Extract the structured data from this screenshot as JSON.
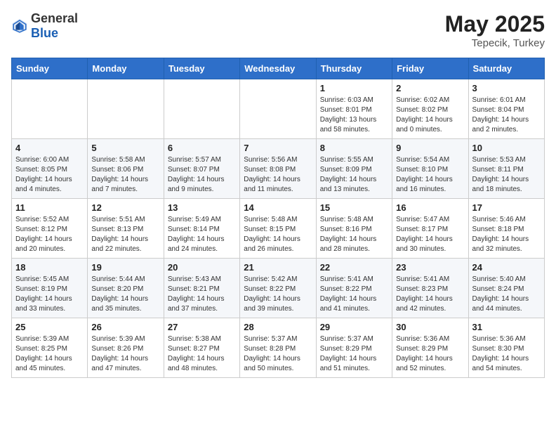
{
  "header": {
    "logo_general": "General",
    "logo_blue": "Blue",
    "month_year": "May 2025",
    "location": "Tepecik, Turkey"
  },
  "weekdays": [
    "Sunday",
    "Monday",
    "Tuesday",
    "Wednesday",
    "Thursday",
    "Friday",
    "Saturday"
  ],
  "weeks": [
    [
      {
        "day": "",
        "info": ""
      },
      {
        "day": "",
        "info": ""
      },
      {
        "day": "",
        "info": ""
      },
      {
        "day": "",
        "info": ""
      },
      {
        "day": "1",
        "info": "Sunrise: 6:03 AM\nSunset: 8:01 PM\nDaylight: 13 hours\nand 58 minutes."
      },
      {
        "day": "2",
        "info": "Sunrise: 6:02 AM\nSunset: 8:02 PM\nDaylight: 14 hours\nand 0 minutes."
      },
      {
        "day": "3",
        "info": "Sunrise: 6:01 AM\nSunset: 8:04 PM\nDaylight: 14 hours\nand 2 minutes."
      }
    ],
    [
      {
        "day": "4",
        "info": "Sunrise: 6:00 AM\nSunset: 8:05 PM\nDaylight: 14 hours\nand 4 minutes."
      },
      {
        "day": "5",
        "info": "Sunrise: 5:58 AM\nSunset: 8:06 PM\nDaylight: 14 hours\nand 7 minutes."
      },
      {
        "day": "6",
        "info": "Sunrise: 5:57 AM\nSunset: 8:07 PM\nDaylight: 14 hours\nand 9 minutes."
      },
      {
        "day": "7",
        "info": "Sunrise: 5:56 AM\nSunset: 8:08 PM\nDaylight: 14 hours\nand 11 minutes."
      },
      {
        "day": "8",
        "info": "Sunrise: 5:55 AM\nSunset: 8:09 PM\nDaylight: 14 hours\nand 13 minutes."
      },
      {
        "day": "9",
        "info": "Sunrise: 5:54 AM\nSunset: 8:10 PM\nDaylight: 14 hours\nand 16 minutes."
      },
      {
        "day": "10",
        "info": "Sunrise: 5:53 AM\nSunset: 8:11 PM\nDaylight: 14 hours\nand 18 minutes."
      }
    ],
    [
      {
        "day": "11",
        "info": "Sunrise: 5:52 AM\nSunset: 8:12 PM\nDaylight: 14 hours\nand 20 minutes."
      },
      {
        "day": "12",
        "info": "Sunrise: 5:51 AM\nSunset: 8:13 PM\nDaylight: 14 hours\nand 22 minutes."
      },
      {
        "day": "13",
        "info": "Sunrise: 5:49 AM\nSunset: 8:14 PM\nDaylight: 14 hours\nand 24 minutes."
      },
      {
        "day": "14",
        "info": "Sunrise: 5:48 AM\nSunset: 8:15 PM\nDaylight: 14 hours\nand 26 minutes."
      },
      {
        "day": "15",
        "info": "Sunrise: 5:48 AM\nSunset: 8:16 PM\nDaylight: 14 hours\nand 28 minutes."
      },
      {
        "day": "16",
        "info": "Sunrise: 5:47 AM\nSunset: 8:17 PM\nDaylight: 14 hours\nand 30 minutes."
      },
      {
        "day": "17",
        "info": "Sunrise: 5:46 AM\nSunset: 8:18 PM\nDaylight: 14 hours\nand 32 minutes."
      }
    ],
    [
      {
        "day": "18",
        "info": "Sunrise: 5:45 AM\nSunset: 8:19 PM\nDaylight: 14 hours\nand 33 minutes."
      },
      {
        "day": "19",
        "info": "Sunrise: 5:44 AM\nSunset: 8:20 PM\nDaylight: 14 hours\nand 35 minutes."
      },
      {
        "day": "20",
        "info": "Sunrise: 5:43 AM\nSunset: 8:21 PM\nDaylight: 14 hours\nand 37 minutes."
      },
      {
        "day": "21",
        "info": "Sunrise: 5:42 AM\nSunset: 8:22 PM\nDaylight: 14 hours\nand 39 minutes."
      },
      {
        "day": "22",
        "info": "Sunrise: 5:41 AM\nSunset: 8:22 PM\nDaylight: 14 hours\nand 41 minutes."
      },
      {
        "day": "23",
        "info": "Sunrise: 5:41 AM\nSunset: 8:23 PM\nDaylight: 14 hours\nand 42 minutes."
      },
      {
        "day": "24",
        "info": "Sunrise: 5:40 AM\nSunset: 8:24 PM\nDaylight: 14 hours\nand 44 minutes."
      }
    ],
    [
      {
        "day": "25",
        "info": "Sunrise: 5:39 AM\nSunset: 8:25 PM\nDaylight: 14 hours\nand 45 minutes."
      },
      {
        "day": "26",
        "info": "Sunrise: 5:39 AM\nSunset: 8:26 PM\nDaylight: 14 hours\nand 47 minutes."
      },
      {
        "day": "27",
        "info": "Sunrise: 5:38 AM\nSunset: 8:27 PM\nDaylight: 14 hours\nand 48 minutes."
      },
      {
        "day": "28",
        "info": "Sunrise: 5:37 AM\nSunset: 8:28 PM\nDaylight: 14 hours\nand 50 minutes."
      },
      {
        "day": "29",
        "info": "Sunrise: 5:37 AM\nSunset: 8:29 PM\nDaylight: 14 hours\nand 51 minutes."
      },
      {
        "day": "30",
        "info": "Sunrise: 5:36 AM\nSunset: 8:29 PM\nDaylight: 14 hours\nand 52 minutes."
      },
      {
        "day": "31",
        "info": "Sunrise: 5:36 AM\nSunset: 8:30 PM\nDaylight: 14 hours\nand 54 minutes."
      }
    ]
  ]
}
